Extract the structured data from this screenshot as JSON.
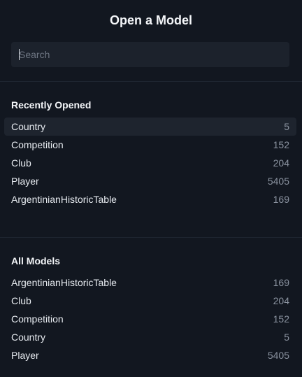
{
  "title": "Open a Model",
  "search": {
    "placeholder": "Search",
    "value": ""
  },
  "recent": {
    "heading": "Recently Opened",
    "items": [
      {
        "name": "Country",
        "count": "5"
      },
      {
        "name": "Competition",
        "count": "152"
      },
      {
        "name": "Club",
        "count": "204"
      },
      {
        "name": "Player",
        "count": "5405"
      },
      {
        "name": "ArgentinianHistoricTable",
        "count": "169"
      }
    ]
  },
  "all": {
    "heading": "All Models",
    "items": [
      {
        "name": "ArgentinianHistoricTable",
        "count": "169"
      },
      {
        "name": "Club",
        "count": "204"
      },
      {
        "name": "Competition",
        "count": "152"
      },
      {
        "name": "Country",
        "count": "5"
      },
      {
        "name": "Player",
        "count": "5405"
      }
    ]
  }
}
